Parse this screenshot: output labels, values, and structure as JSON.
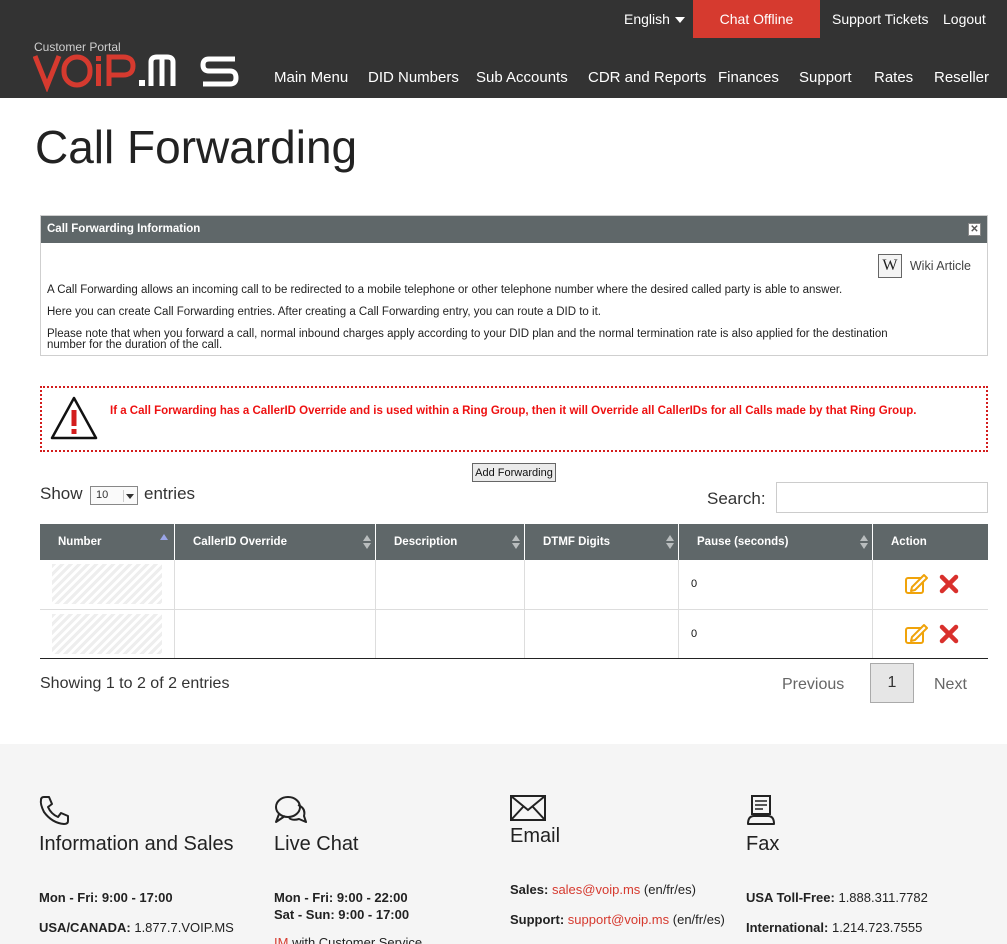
{
  "header": {
    "language": "English",
    "chat_button": "Chat Offline",
    "support_tickets": "Support Tickets",
    "logout": "Logout",
    "portal_label": "Customer Portal",
    "logo_text": "VOIP.MS",
    "nav": [
      "Main Menu",
      "DID Numbers",
      "Sub Accounts",
      "CDR and Reports",
      "Finances",
      "Support",
      "Rates",
      "Reseller"
    ]
  },
  "page_title": "Call Forwarding",
  "info_panel": {
    "title": "Call Forwarding Information",
    "wiki_label": "Wiki Article",
    "line1": "A Call Forwarding allows an incoming call to be redirected to a mobile telephone or other telephone number where the desired called party is able to answer.",
    "line2": "Here you can create Call Forwarding entries. After creating a Call Forwarding entry, you can route a DID to it.",
    "line3a": "Please note that when you forward a call, normal inbound charges apply according to your DID plan and the normal termination rate is also applied for the destination",
    "line3b": "number for the duration of the call."
  },
  "warning": {
    "text": "If a Call Forwarding has a CallerID Override and is used within a Ring Group, then it will Override all CallerIDs for all Calls made by that Ring Group."
  },
  "controls": {
    "add_button": "Add Forwarding",
    "show": "Show",
    "entries": "entries",
    "page_size": "10",
    "search_label": "Search:",
    "search_value": ""
  },
  "table": {
    "headers": [
      "Number",
      "CallerID Override",
      "Description",
      "DTMF Digits",
      "Pause (seconds)",
      "Action"
    ],
    "rows": [
      {
        "number": "",
        "callerid": "",
        "description": "",
        "dtmf": "",
        "pause": "0"
      },
      {
        "number": "",
        "callerid": "",
        "description": "",
        "dtmf": "",
        "pause": "0"
      }
    ]
  },
  "pagination": {
    "showing": "Showing 1 to 2 of 2 entries",
    "previous": "Previous",
    "page": "1",
    "next": "Next"
  },
  "footer": {
    "info": {
      "title": "Information and Sales",
      "hours_label": "Mon - Fri: 9:00 - 17:00",
      "phone_label": "USA/CANADA:",
      "phone_value": "1.877.7.VOIP.MS"
    },
    "chat": {
      "title": "Live Chat",
      "hours1": "Mon - Fri: 9:00 - 22:00",
      "hours2": "Sat - Sun: 9:00 - 17:00",
      "im_link": "IM",
      "im_rest": " with Customer Service"
    },
    "email": {
      "title": "Email",
      "sales_label": "Sales:",
      "sales_email": "sales@voip.ms",
      "sales_lang": "(en/fr/es)",
      "support_label": "Support:",
      "support_email": "support@voip.ms",
      "support_lang": "(en/fr/es)"
    },
    "fax": {
      "title": "Fax",
      "usa_label": "USA Toll-Free:",
      "usa_value": "1.888.311.7782",
      "intl_label": "International:",
      "intl_value": "1.214.723.7555"
    }
  },
  "colors": {
    "header_bg": "#333333",
    "accent_red": "#d63a2f",
    "panel_head": "#5f6769",
    "edit_icon": "#f0a30a",
    "delete_icon": "#d9302c"
  }
}
